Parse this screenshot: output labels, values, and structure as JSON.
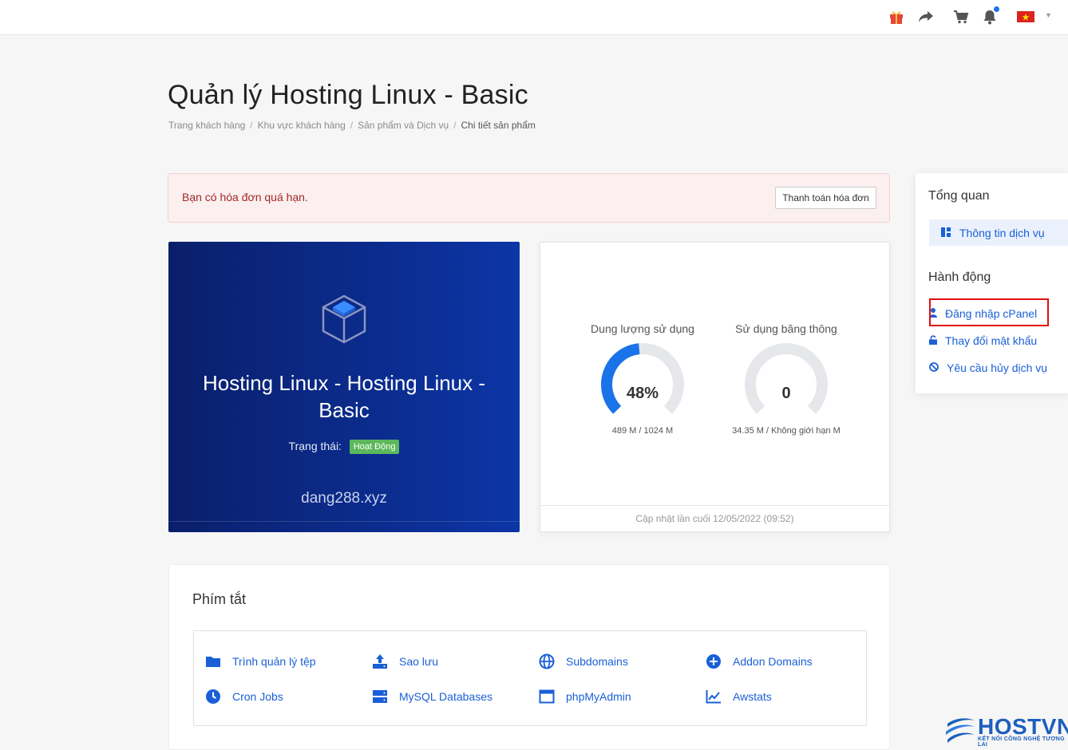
{
  "topbar": {
    "icons": [
      "gift-icon",
      "share-icon",
      "cart-icon",
      "bell-icon",
      "vietnam-flag-icon"
    ]
  },
  "header": {
    "title": "Quản lý Hosting Linux - Basic",
    "breadcrumb": [
      "Trang khách hàng",
      "Khu vực khách hàng",
      "Sản phẩm và Dịch vụ",
      "Chi tiết sản phẩm"
    ]
  },
  "alert": {
    "message": "Bạn có hóa đơn quá hạn.",
    "button": "Thanh toán hóa đơn"
  },
  "product": {
    "name": "Hosting Linux - Hosting Linux - Basic",
    "status_label": "Trạng thái:",
    "status_badge": "Hoạt Động",
    "domain": "dang288.xyz",
    "colors": {
      "gradient_start": "#0a1f6b",
      "gradient_end": "#0c35a6",
      "badge": "#5cb85c"
    }
  },
  "usage": {
    "disk": {
      "title": "Dung lượng sử dụng",
      "value": "48%",
      "fraction": 0.48,
      "detail": "489 M / 1024 M",
      "color": "#1a73e8"
    },
    "bandwidth": {
      "title": "Sử dụng băng thông",
      "value": "0",
      "fraction": 0,
      "detail": "34.35 M / Không giới hạn M",
      "color": "#1a73e8"
    },
    "footer": "Cập nhật lần cuối 12/05/2022 (09:52)"
  },
  "shortcuts": {
    "title": "Phím tắt",
    "items": [
      {
        "label": "Trình quản lý tệp",
        "icon": "folder-icon"
      },
      {
        "label": "Sao lưu",
        "icon": "upload-icon"
      },
      {
        "label": "Subdomains",
        "icon": "globe-icon"
      },
      {
        "label": "Addon Domains",
        "icon": "plus-circle-icon"
      },
      {
        "label": "Cron Jobs",
        "icon": "clock-icon"
      },
      {
        "label": "MySQL Databases",
        "icon": "database-icon"
      },
      {
        "label": "phpMyAdmin",
        "icon": "window-icon"
      },
      {
        "label": "Awstats",
        "icon": "line-chart-icon"
      }
    ]
  },
  "sidebar": {
    "overview_heading": "Tổng quan",
    "overview_item": "Thông tin dịch vụ",
    "actions_heading": "Hành động",
    "actions": [
      {
        "label": "Đăng nhập cPanel",
        "icon": "user-icon"
      },
      {
        "label": "Thay đổi mật khẩu",
        "icon": "unlock-icon"
      },
      {
        "label": "Yêu cầu hủy dịch vụ",
        "icon": "ban-icon"
      }
    ]
  },
  "logo": {
    "name": "HOSTVN",
    "tagline": "KẾT NỐI CÔNG NGHỆ TƯƠNG LAI"
  }
}
